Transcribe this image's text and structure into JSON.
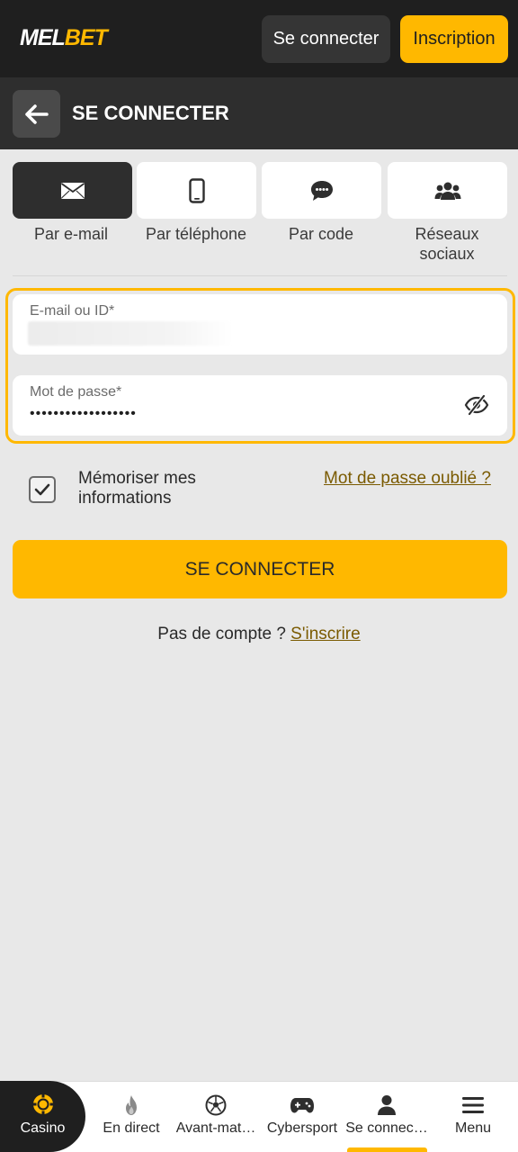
{
  "header": {
    "logo_mel": "MEL",
    "logo_bet": "BET",
    "login_label": "Se connecter",
    "register_label": "Inscription"
  },
  "titlebar": {
    "title": "SE CONNECTER"
  },
  "tabs": [
    {
      "label": "Par e-mail",
      "icon": "envelope-icon",
      "active": true
    },
    {
      "label": "Par téléphone",
      "icon": "phone-icon",
      "active": false
    },
    {
      "label": "Par code",
      "icon": "chat-bubble-icon",
      "active": false
    },
    {
      "label": "Réseaux sociaux",
      "icon": "users-icon",
      "active": false
    }
  ],
  "form": {
    "email_label": "E-mail ou ID*",
    "password_label": "Mot de passe*",
    "password_value": "••••••••••••••••••",
    "remember_label": "Mémoriser mes informations",
    "remember_checked": true,
    "forgot_label": "Mot de passe oublié ?",
    "submit_label": "SE CONNECTER",
    "no_account_text": "Pas de compte ? ",
    "signup_link": "S'inscrire"
  },
  "bottom_nav": [
    {
      "label": "Casino",
      "icon": "casino-chip-icon"
    },
    {
      "label": "En direct",
      "icon": "flame-icon"
    },
    {
      "label": "Avant-mat…",
      "icon": "soccer-ball-icon"
    },
    {
      "label": "Cybersport",
      "icon": "gamepad-icon"
    },
    {
      "label": "Se connec…",
      "icon": "user-icon",
      "active": true
    },
    {
      "label": "Menu",
      "icon": "menu-icon"
    }
  ],
  "colors": {
    "accent": "#ffb800",
    "dark": "#1f1f1f",
    "background": "#e8e8e8",
    "link": "#7a5a00"
  }
}
